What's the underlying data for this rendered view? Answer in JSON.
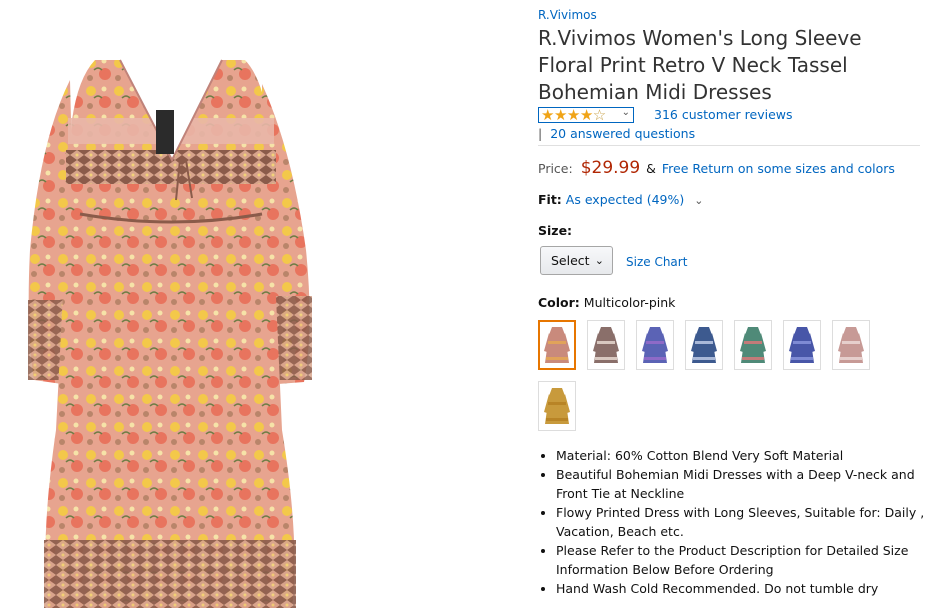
{
  "product": {
    "brand": "R.Vivimos",
    "title": "R.Vivimos Women's Long Sleeve Floral Print Retro V Neck Tassel Bohemian Midi Dresses",
    "rating_out_of_5": 4,
    "reviews_label": "316 customer reviews",
    "qa_separator": "|",
    "qa_label": "20 answered questions",
    "price_label": "Price:",
    "price": "$29.99",
    "price_amp": "&",
    "free_return": "Free Return on some sizes and colors",
    "fit_label": "Fit:",
    "fit_value": "As expected (49%)",
    "size_label": "Size:",
    "size_select": "Select",
    "size_chart": "Size Chart",
    "color_label": "Color:",
    "color_value": "Multicolor-pink",
    "swatches": [
      {
        "color": "#c98a7c",
        "accent": "#e1a35a"
      },
      {
        "color": "#8a6f6a",
        "accent": "#d8c8c0"
      },
      {
        "color": "#5b63b5",
        "accent": "#8e6ac7"
      },
      {
        "color": "#3d5a8f",
        "accent": "#a9b8d8"
      },
      {
        "color": "#4f8a78",
        "accent": "#c27b79"
      },
      {
        "color": "#4856a8",
        "accent": "#7e8ad4"
      },
      {
        "color": "#c79a96",
        "accent": "#e6cfcc"
      },
      {
        "color": "#c89a3c",
        "accent": "#b88426"
      }
    ],
    "bullets": [
      "Material: 60% Cotton Blend Very Soft Material",
      "Beautiful Bohemian Midi Dresses with a Deep V-neck and Front Tie at Neckline",
      "Flowy Printed Dress with Long Sleeves, Suitable for: Daily , Vacation, Beach etc.",
      "Please Refer to the Product Description for Detailed Size Information Below Before Ordering",
      "Hand Wash Cold Recommended. Do not tumble dry"
    ]
  },
  "colors": {
    "link": "#0066c0",
    "price": "#b12704",
    "star": "#f0a417",
    "selected_border": "#e77600"
  },
  "icons": {
    "stars": "star-rating-icon",
    "chevron": "chevron-down-icon"
  }
}
